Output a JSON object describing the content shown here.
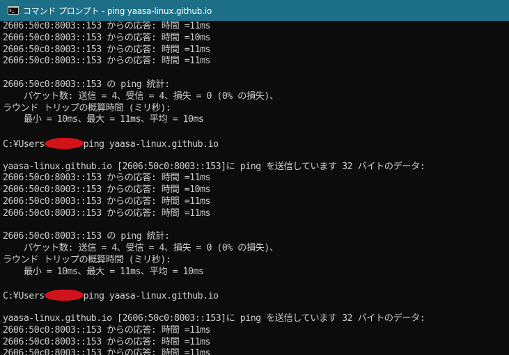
{
  "window": {
    "title": "コマンド プロンプト - ping  yaasa-linux.github.io",
    "icon": "cmd-icon",
    "titlebar_color": "#1c6f87",
    "background": "#0c0c0c",
    "text_color": "#cccccc"
  },
  "console": {
    "line_1": "2606:50c0:8003::153 からの応答: 時間 =11ms",
    "line_2": "2606:50c0:8003::153 からの応答: 時間 =10ms",
    "line_3": "2606:50c0:8003::153 からの応答: 時間 =11ms",
    "line_4": "2606:50c0:8003::153 からの応答: 時間 =11ms",
    "line_6": "2606:50c0:8003::153 の ping 統計:",
    "line_7": "    パケット数: 送信 = 4、受信 = 4、損失 = 0 (0% の損失)、",
    "line_8": "ラウンド トリップの概算時間 (ミリ秒):",
    "line_9": "    最小 = 10ms、最大 = 11ms、平均 = 10ms",
    "line_11_a": "C:¥Users",
    "line_11_b": "ping yaasa-linux.github.io",
    "line_13": "yaasa-linux.github.io [2606:50c0:8003::153]に ping を送信しています 32 バイトのデータ:",
    "line_14": "2606:50c0:8003::153 からの応答: 時間 =11ms",
    "line_15": "2606:50c0:8003::153 からの応答: 時間 =10ms",
    "line_16": "2606:50c0:8003::153 からの応答: 時間 =11ms",
    "line_17": "2606:50c0:8003::153 からの応答: 時間 =11ms",
    "line_19": "2606:50c0:8003::153 の ping 統計:",
    "line_20": "    パケット数: 送信 = 4、受信 = 4、損失 = 0 (0% の損失)、",
    "line_21": "ラウンド トリップの概算時間 (ミリ秒):",
    "line_22": "    最小 = 10ms、最大 = 11ms、平均 = 10ms",
    "line_24_a": "C:¥Users",
    "line_24_b": "ping yaasa-linux.github.io",
    "line_26": "yaasa-linux.github.io [2606:50c0:8003::153]に ping を送信しています 32 バイトのデータ:",
    "line_27": "2606:50c0:8003::153 からの応答: 時間 =11ms",
    "line_28": "2606:50c0:8003::153 からの応答: 時間 =11ms",
    "line_29": "2606:50c0:8003::153 からの応答: 時間 =11ms"
  }
}
